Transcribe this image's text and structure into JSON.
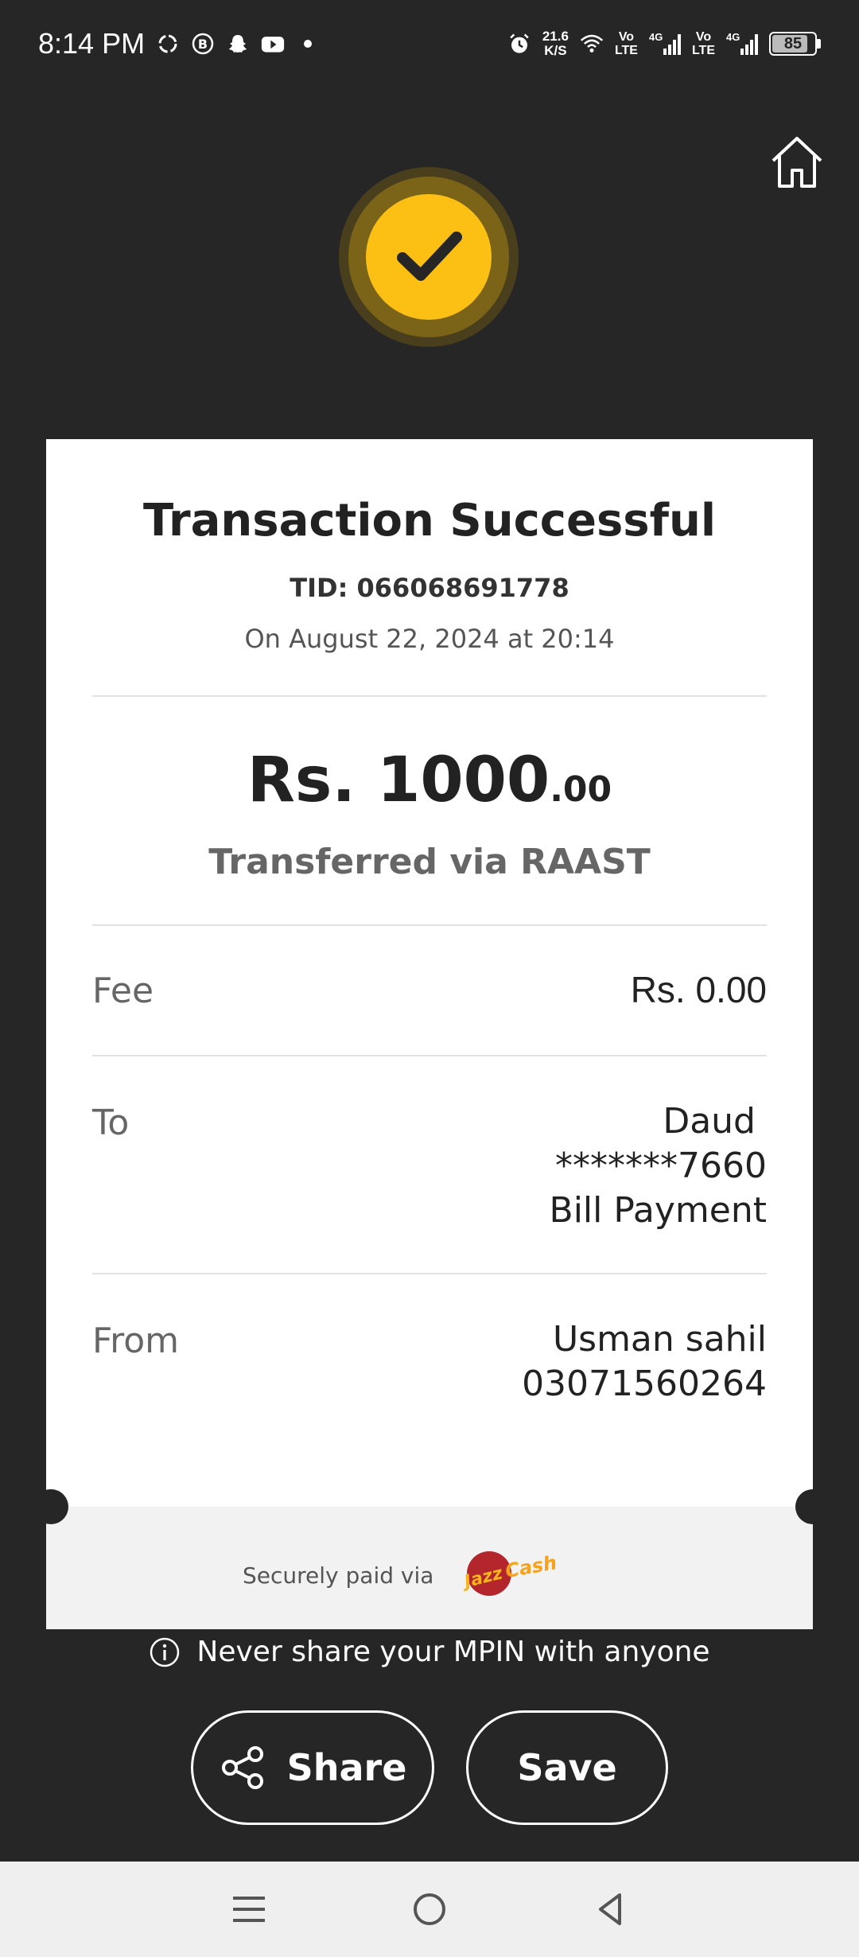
{
  "status_bar": {
    "time": "8:14 PM",
    "net_speed_value": "21.6",
    "net_speed_unit": "K/S",
    "volte_1": "Vo\nLTE",
    "volte_2": "Vo\nLTE",
    "network_1": "4G",
    "network_2": "4G",
    "battery_level": "85",
    "battery_fraction": 0.85
  },
  "receipt": {
    "title": "Transaction Successful",
    "tid": "TID: 066068691778",
    "date": "On August 22, 2024 at 20:14",
    "amount_main": "Rs. 1000",
    "amount_cents": ".00",
    "via": "Transferred via RAAST",
    "fee_label": "Fee",
    "fee_value": "Rs. 0.00",
    "to_label": "To",
    "to_name": "Daud",
    "to_account": "*******7660",
    "to_type": "Bill Payment",
    "from_label": "From",
    "from_name": "Usman sahil",
    "from_number": "03071560264",
    "secure_text": "Securely paid via"
  },
  "warning_text": "Never share your MPIN with anyone",
  "actions": {
    "share_label": "Share",
    "save_label": "Save"
  },
  "colors": {
    "accent_yellow": "#fcc015",
    "background": "#262626",
    "card": "#ffffff"
  },
  "icons": {
    "home": "home-icon",
    "check": "check-icon",
    "share": "share-icon",
    "info": "info-icon",
    "menu": "menu-icon",
    "home_nav": "circle-home-icon",
    "back": "back-icon"
  }
}
